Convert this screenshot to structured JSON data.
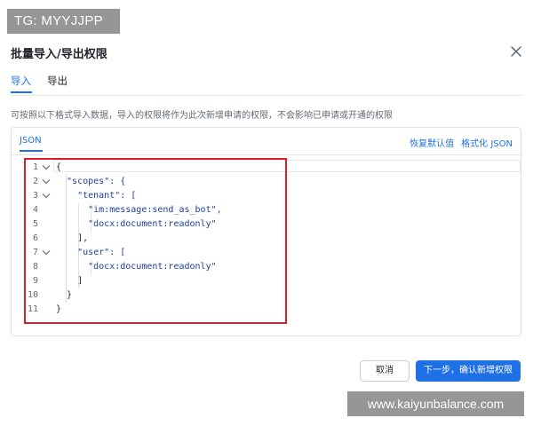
{
  "watermark_top": "TG: MYYJJPP",
  "watermark_bottom": "www.kaiyunbalance.com",
  "dialog": {
    "title": "批量导入/导出权限",
    "close_icon": "close-icon"
  },
  "tabs": [
    {
      "label": "导入",
      "active": true
    },
    {
      "label": "导出",
      "active": false
    }
  ],
  "description": "可按照以下格式导入数据，导入的权限将作为此次新增申请的权限，不会影响已申请或开通的权限",
  "editor": {
    "tab_label": "JSON",
    "actions": {
      "reset_label": "恢复默认值",
      "format_label": "格式化 JSON"
    },
    "lines": [
      {
        "n": "1",
        "text": "{"
      },
      {
        "n": "2",
        "text": "  \"scopes\": {"
      },
      {
        "n": "3",
        "text": "    \"tenant\": ["
      },
      {
        "n": "4",
        "text": "      \"im:message:send_as_bot\","
      },
      {
        "n": "5",
        "text": "      \"docx:document:readonly\""
      },
      {
        "n": "6",
        "text": "    ],"
      },
      {
        "n": "7",
        "text": "    \"user\": ["
      },
      {
        "n": "8",
        "text": "      \"docx:document:readonly\""
      },
      {
        "n": "9",
        "text": "    ]"
      },
      {
        "n": "10",
        "text": "  }"
      },
      {
        "n": "11",
        "text": "}"
      }
    ],
    "highlight_color": "#d91e2a"
  },
  "footer": {
    "cancel_label": "取消",
    "next_label": "下一步，确认新增权限"
  },
  "colors": {
    "accent": "#1f6fe5",
    "highlight_box": "#d91e2a"
  }
}
